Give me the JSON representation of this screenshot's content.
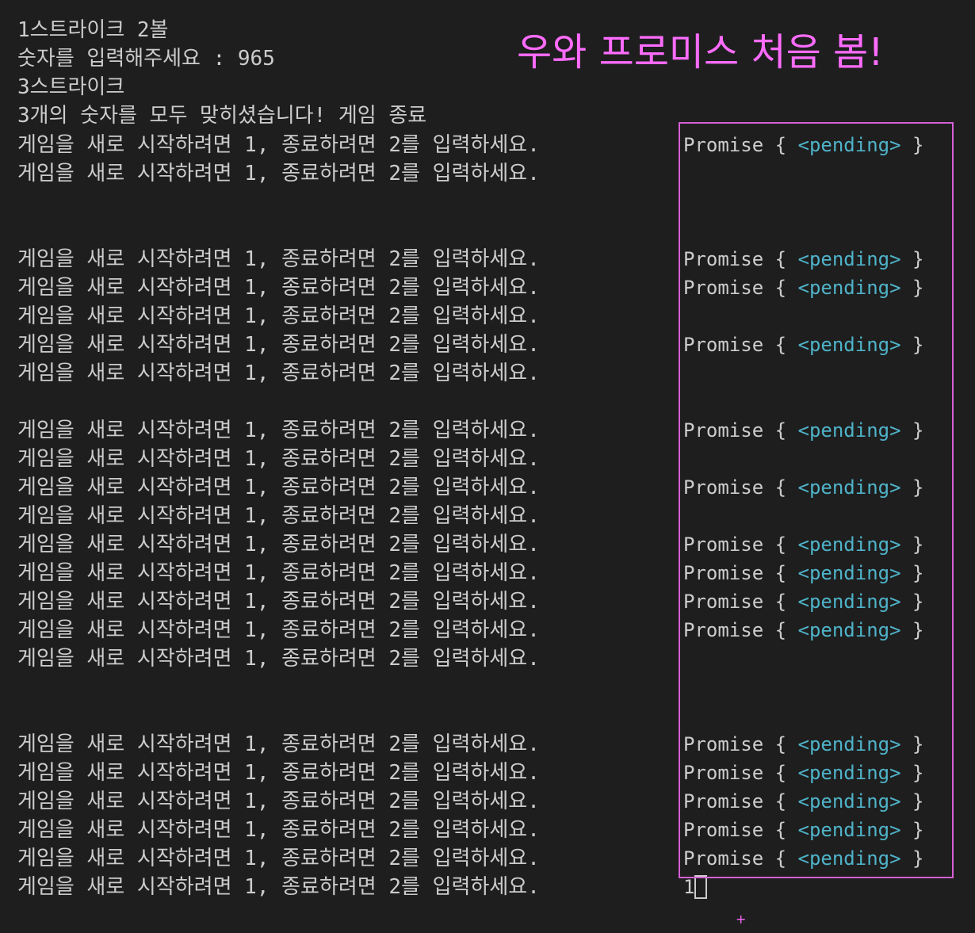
{
  "output": {
    "strike_ball": "1스트라이크 2볼",
    "input_prompt": "숫자를 입력해주세요 : 965",
    "strike3": "3스트라이크",
    "game_over": "3개의 숫자를 모두 맞히셨습니다! 게임 종료"
  },
  "restart_prompt": "게임을 새로 시작하려면 1, 종료하려면 2를 입력하세요.",
  "promise": {
    "open": "Promise { ",
    "pending": "<pending>",
    "close": " }"
  },
  "typed_input": "1",
  "annotation": {
    "note": "우와 프로미스 처음 봄!",
    "plus": "+",
    "box_color": "#d55fd5",
    "text_color": "#ff6cff"
  },
  "colors": {
    "background": "#1e1e1e",
    "text": "#cccccc",
    "pending": "#4fb3c9"
  }
}
